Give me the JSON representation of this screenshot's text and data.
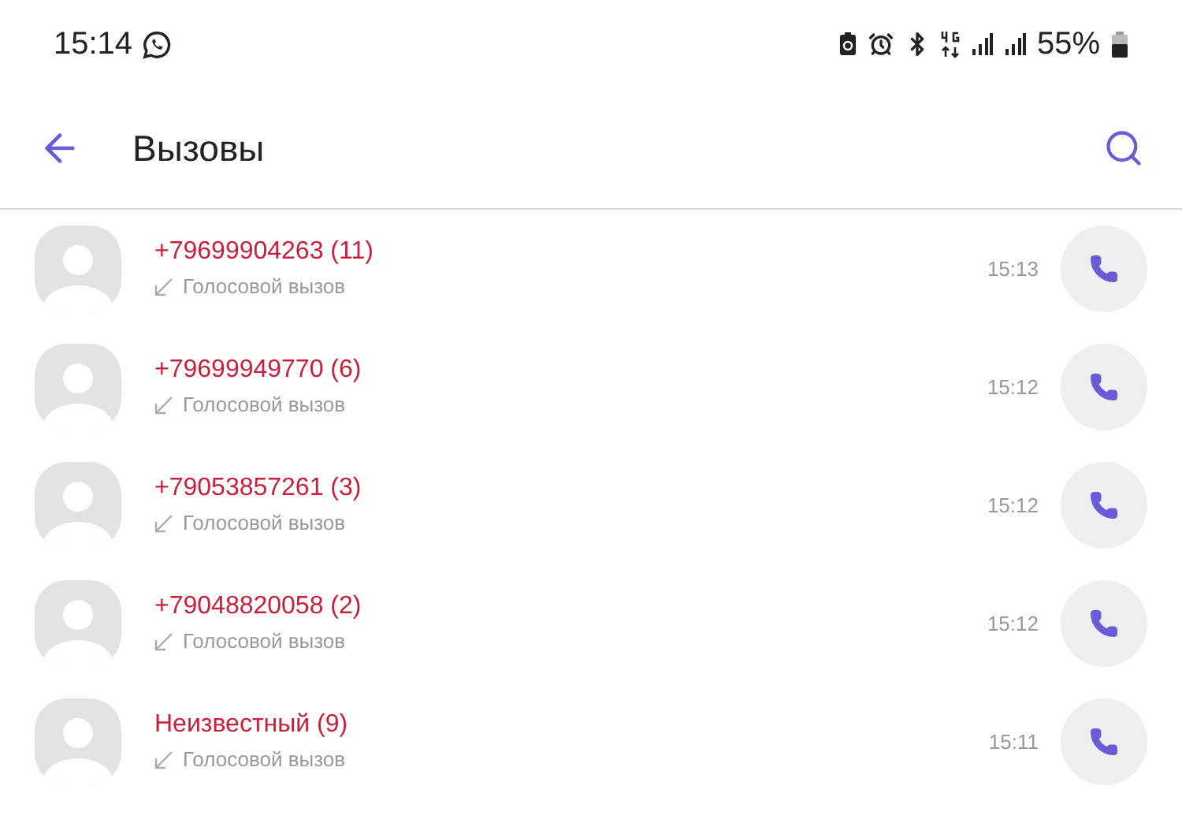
{
  "status_bar": {
    "time": "15:14",
    "battery": "55%"
  },
  "toolbar": {
    "title": "Вызовы"
  },
  "calls": [
    {
      "name": "+79699904263 (11)",
      "missed": true,
      "type": "Голосовой вызов",
      "time": "15:13"
    },
    {
      "name": "+79699949770 (6)",
      "missed": true,
      "type": "Голосовой вызов",
      "time": "15:12"
    },
    {
      "name": "+79053857261 (3)",
      "missed": true,
      "type": "Голосовой вызов",
      "time": "15:12"
    },
    {
      "name": "+79048820058 (2)",
      "missed": true,
      "type": "Голосовой вызов",
      "time": "15:12"
    },
    {
      "name": "Неизвестный (9)",
      "missed": true,
      "type": "Голосовой вызов",
      "time": "15:11"
    }
  ]
}
